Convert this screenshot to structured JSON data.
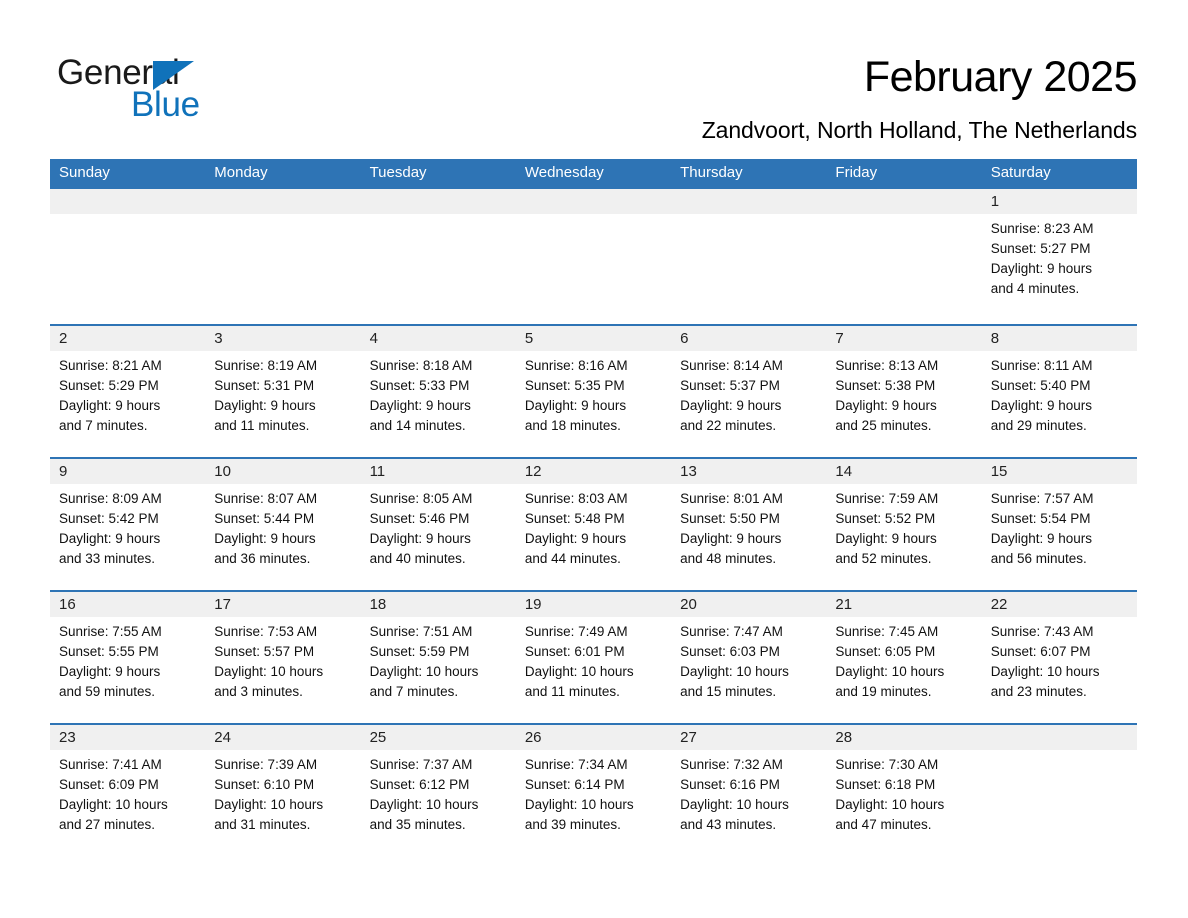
{
  "logo": {
    "word_one": "General",
    "word_two": "Blue",
    "triangle_color": "#1072ba",
    "text_color": "#1a1a1a"
  },
  "header": {
    "month_title": "February 2025",
    "location": "Zandvoort, North Holland, The Netherlands"
  },
  "theme": {
    "header_blue": "#2e74b5",
    "row_divider_blue": "#2e74b5",
    "daynum_band_gray": "#f0f0f0",
    "text_black": "#111111",
    "page_background": "#ffffff"
  },
  "weekdays": [
    "Sunday",
    "Monday",
    "Tuesday",
    "Wednesday",
    "Thursday",
    "Friday",
    "Saturday"
  ],
  "weeks": [
    [
      {
        "day": "",
        "sunrise": "",
        "sunset": "",
        "daylight_line1": "",
        "daylight_line2": ""
      },
      {
        "day": "",
        "sunrise": "",
        "sunset": "",
        "daylight_line1": "",
        "daylight_line2": ""
      },
      {
        "day": "",
        "sunrise": "",
        "sunset": "",
        "daylight_line1": "",
        "daylight_line2": ""
      },
      {
        "day": "",
        "sunrise": "",
        "sunset": "",
        "daylight_line1": "",
        "daylight_line2": ""
      },
      {
        "day": "",
        "sunrise": "",
        "sunset": "",
        "daylight_line1": "",
        "daylight_line2": ""
      },
      {
        "day": "",
        "sunrise": "",
        "sunset": "",
        "daylight_line1": "",
        "daylight_line2": ""
      },
      {
        "day": "1",
        "sunrise": "Sunrise: 8:23 AM",
        "sunset": "Sunset: 5:27 PM",
        "daylight_line1": "Daylight: 9 hours",
        "daylight_line2": "and 4 minutes."
      }
    ],
    [
      {
        "day": "2",
        "sunrise": "Sunrise: 8:21 AM",
        "sunset": "Sunset: 5:29 PM",
        "daylight_line1": "Daylight: 9 hours",
        "daylight_line2": "and 7 minutes."
      },
      {
        "day": "3",
        "sunrise": "Sunrise: 8:19 AM",
        "sunset": "Sunset: 5:31 PM",
        "daylight_line1": "Daylight: 9 hours",
        "daylight_line2": "and 11 minutes."
      },
      {
        "day": "4",
        "sunrise": "Sunrise: 8:18 AM",
        "sunset": "Sunset: 5:33 PM",
        "daylight_line1": "Daylight: 9 hours",
        "daylight_line2": "and 14 minutes."
      },
      {
        "day": "5",
        "sunrise": "Sunrise: 8:16 AM",
        "sunset": "Sunset: 5:35 PM",
        "daylight_line1": "Daylight: 9 hours",
        "daylight_line2": "and 18 minutes."
      },
      {
        "day": "6",
        "sunrise": "Sunrise: 8:14 AM",
        "sunset": "Sunset: 5:37 PM",
        "daylight_line1": "Daylight: 9 hours",
        "daylight_line2": "and 22 minutes."
      },
      {
        "day": "7",
        "sunrise": "Sunrise: 8:13 AM",
        "sunset": "Sunset: 5:38 PM",
        "daylight_line1": "Daylight: 9 hours",
        "daylight_line2": "and 25 minutes."
      },
      {
        "day": "8",
        "sunrise": "Sunrise: 8:11 AM",
        "sunset": "Sunset: 5:40 PM",
        "daylight_line1": "Daylight: 9 hours",
        "daylight_line2": "and 29 minutes."
      }
    ],
    [
      {
        "day": "9",
        "sunrise": "Sunrise: 8:09 AM",
        "sunset": "Sunset: 5:42 PM",
        "daylight_line1": "Daylight: 9 hours",
        "daylight_line2": "and 33 minutes."
      },
      {
        "day": "10",
        "sunrise": "Sunrise: 8:07 AM",
        "sunset": "Sunset: 5:44 PM",
        "daylight_line1": "Daylight: 9 hours",
        "daylight_line2": "and 36 minutes."
      },
      {
        "day": "11",
        "sunrise": "Sunrise: 8:05 AM",
        "sunset": "Sunset: 5:46 PM",
        "daylight_line1": "Daylight: 9 hours",
        "daylight_line2": "and 40 minutes."
      },
      {
        "day": "12",
        "sunrise": "Sunrise: 8:03 AM",
        "sunset": "Sunset: 5:48 PM",
        "daylight_line1": "Daylight: 9 hours",
        "daylight_line2": "and 44 minutes."
      },
      {
        "day": "13",
        "sunrise": "Sunrise: 8:01 AM",
        "sunset": "Sunset: 5:50 PM",
        "daylight_line1": "Daylight: 9 hours",
        "daylight_line2": "and 48 minutes."
      },
      {
        "day": "14",
        "sunrise": "Sunrise: 7:59 AM",
        "sunset": "Sunset: 5:52 PM",
        "daylight_line1": "Daylight: 9 hours",
        "daylight_line2": "and 52 minutes."
      },
      {
        "day": "15",
        "sunrise": "Sunrise: 7:57 AM",
        "sunset": "Sunset: 5:54 PM",
        "daylight_line1": "Daylight: 9 hours",
        "daylight_line2": "and 56 minutes."
      }
    ],
    [
      {
        "day": "16",
        "sunrise": "Sunrise: 7:55 AM",
        "sunset": "Sunset: 5:55 PM",
        "daylight_line1": "Daylight: 9 hours",
        "daylight_line2": "and 59 minutes."
      },
      {
        "day": "17",
        "sunrise": "Sunrise: 7:53 AM",
        "sunset": "Sunset: 5:57 PM",
        "daylight_line1": "Daylight: 10 hours",
        "daylight_line2": "and 3 minutes."
      },
      {
        "day": "18",
        "sunrise": "Sunrise: 7:51 AM",
        "sunset": "Sunset: 5:59 PM",
        "daylight_line1": "Daylight: 10 hours",
        "daylight_line2": "and 7 minutes."
      },
      {
        "day": "19",
        "sunrise": "Sunrise: 7:49 AM",
        "sunset": "Sunset: 6:01 PM",
        "daylight_line1": "Daylight: 10 hours",
        "daylight_line2": "and 11 minutes."
      },
      {
        "day": "20",
        "sunrise": "Sunrise: 7:47 AM",
        "sunset": "Sunset: 6:03 PM",
        "daylight_line1": "Daylight: 10 hours",
        "daylight_line2": "and 15 minutes."
      },
      {
        "day": "21",
        "sunrise": "Sunrise: 7:45 AM",
        "sunset": "Sunset: 6:05 PM",
        "daylight_line1": "Daylight: 10 hours",
        "daylight_line2": "and 19 minutes."
      },
      {
        "day": "22",
        "sunrise": "Sunrise: 7:43 AM",
        "sunset": "Sunset: 6:07 PM",
        "daylight_line1": "Daylight: 10 hours",
        "daylight_line2": "and 23 minutes."
      }
    ],
    [
      {
        "day": "23",
        "sunrise": "Sunrise: 7:41 AM",
        "sunset": "Sunset: 6:09 PM",
        "daylight_line1": "Daylight: 10 hours",
        "daylight_line2": "and 27 minutes."
      },
      {
        "day": "24",
        "sunrise": "Sunrise: 7:39 AM",
        "sunset": "Sunset: 6:10 PM",
        "daylight_line1": "Daylight: 10 hours",
        "daylight_line2": "and 31 minutes."
      },
      {
        "day": "25",
        "sunrise": "Sunrise: 7:37 AM",
        "sunset": "Sunset: 6:12 PM",
        "daylight_line1": "Daylight: 10 hours",
        "daylight_line2": "and 35 minutes."
      },
      {
        "day": "26",
        "sunrise": "Sunrise: 7:34 AM",
        "sunset": "Sunset: 6:14 PM",
        "daylight_line1": "Daylight: 10 hours",
        "daylight_line2": "and 39 minutes."
      },
      {
        "day": "27",
        "sunrise": "Sunrise: 7:32 AM",
        "sunset": "Sunset: 6:16 PM",
        "daylight_line1": "Daylight: 10 hours",
        "daylight_line2": "and 43 minutes."
      },
      {
        "day": "28",
        "sunrise": "Sunrise: 7:30 AM",
        "sunset": "Sunset: 6:18 PM",
        "daylight_line1": "Daylight: 10 hours",
        "daylight_line2": "and 47 minutes."
      },
      {
        "day": "",
        "sunrise": "",
        "sunset": "",
        "daylight_line1": "",
        "daylight_line2": ""
      }
    ]
  ]
}
